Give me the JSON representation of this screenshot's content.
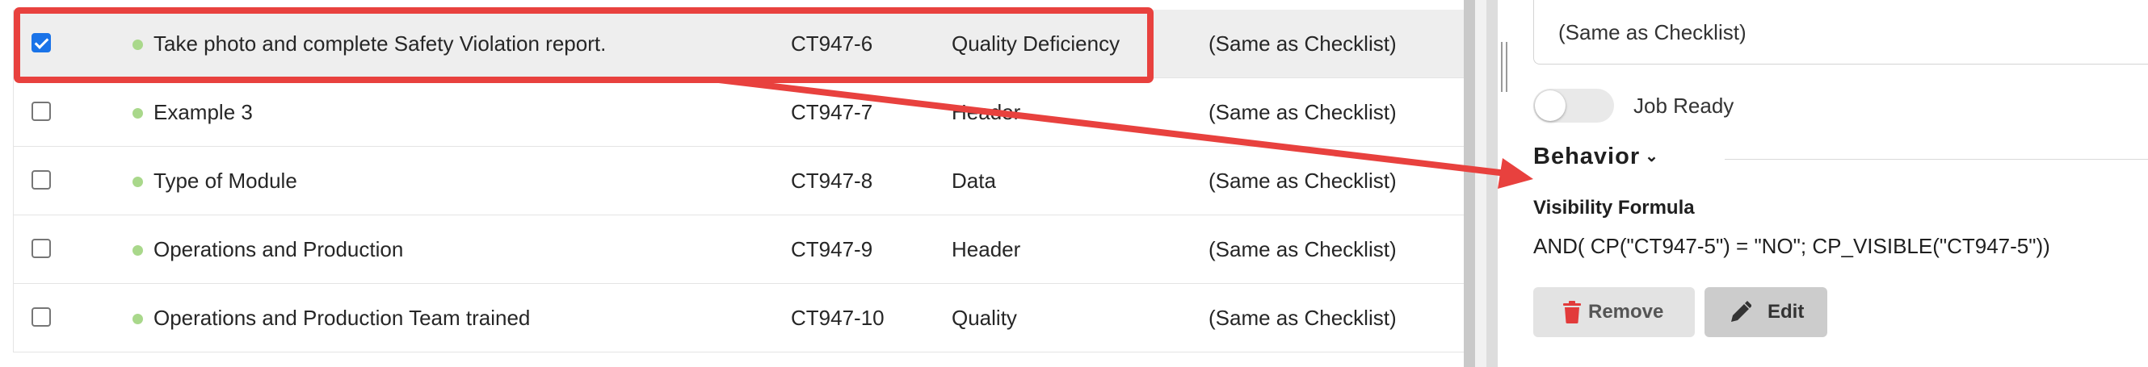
{
  "table": {
    "rows": [
      {
        "name": "Take photo and complete Safety Violation report.",
        "code": "CT947-6",
        "type": "Quality Deficiency",
        "checklist": "(Same as Checklist)",
        "checked": true
      },
      {
        "name": "Example 3",
        "code": "CT947-7",
        "type": "Header",
        "checklist": "(Same as Checklist)",
        "checked": false
      },
      {
        "name": "Type of Module",
        "code": "CT947-8",
        "type": "Data",
        "checklist": "(Same as Checklist)",
        "checked": false
      },
      {
        "name": "Operations and Production",
        "code": "CT947-9",
        "type": "Header",
        "checklist": "(Same as Checklist)",
        "checked": false
      },
      {
        "name": "Operations and Production Team trained",
        "code": "CT947-10",
        "type": "Quality",
        "checklist": "(Same as Checklist)",
        "checked": false
      }
    ]
  },
  "panel": {
    "assignee_value": "(Same as Checklist)",
    "job_ready_label": "Job Ready",
    "job_ready_on": false,
    "behavior_heading": "Behavior",
    "formula_label": "Visibility Formula",
    "formula_text": "AND( CP(\"CT947-5\") = \"NO\"; CP_VISIBLE(\"CT947-5\"))",
    "remove_label": "Remove",
    "edit_label": "Edit"
  },
  "colors": {
    "annotation_red": "#e8413e",
    "status_dot": "#a9d88b",
    "checkbox_blue": "#1a73e8",
    "remove_icon": "#e23b3b"
  },
  "icons": {
    "row_status": "status-dot-icon",
    "behavior_toggle": "chevron-down-icon",
    "remove": "trash-icon",
    "edit": "pencil-icon"
  }
}
